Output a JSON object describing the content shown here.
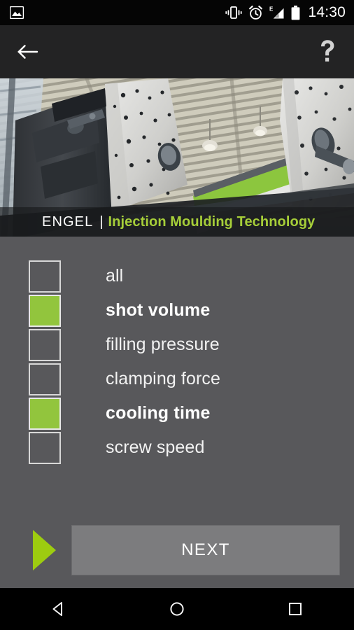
{
  "status_bar": {
    "icons": [
      "image-icon",
      "vibrate-icon",
      "alarm-clock-icon",
      "signal-edge-icon",
      "battery-full-icon"
    ],
    "network_label": "E",
    "time": "14:30"
  },
  "app_bar": {
    "back_icon": "back-arrow-icon",
    "help_icon": "question-mark-icon"
  },
  "hero": {
    "image_alt": "injection moulding machine platen in factory hall",
    "caption": {
      "brand": "ENGEL",
      "separator": "|",
      "tagline": "Injection Moulding Technology"
    }
  },
  "options": {
    "items": [
      {
        "label": "all",
        "checked": false
      },
      {
        "label": "shot volume",
        "checked": true
      },
      {
        "label": "filling pressure",
        "checked": false
      },
      {
        "label": "clamping force",
        "checked": false
      },
      {
        "label": "cooling time",
        "checked": true
      },
      {
        "label": "screw speed",
        "checked": false
      }
    ]
  },
  "footer": {
    "play_icon": "play-triangle-icon",
    "next_label": "NEXT"
  },
  "nav_bar": {
    "back": "nav-back-icon",
    "home": "nav-home-icon",
    "recents": "nav-recents-icon"
  },
  "colors": {
    "accent_green": "#92c53d",
    "tagline_green": "#a6ce39",
    "play_green": "#9dcc10",
    "background": "#58585b",
    "app_bar": "#232324",
    "button": "#7c7c7e"
  }
}
